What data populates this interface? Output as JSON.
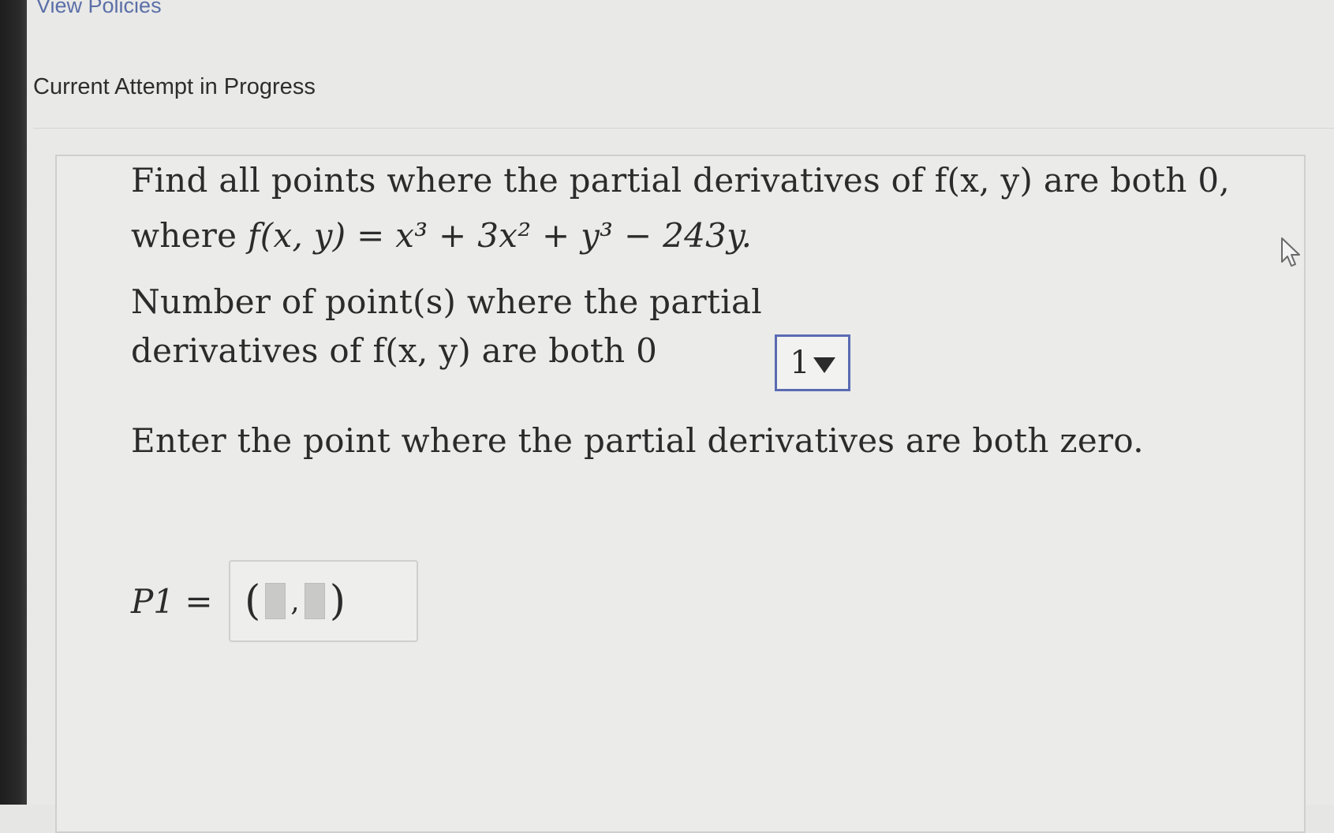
{
  "header": {
    "view_policies": "View Policies",
    "attempt_title": "Current Attempt in Progress"
  },
  "question": {
    "line1": "Find all points where the partial derivatives of f(x, y) are both 0,",
    "line2_prefix": "where ",
    "line2_math": "f(x, y) = x³ + 3x² + y³ − 243y.",
    "line3": "Number of point(s) where the partial",
    "line4": "derivatives of f(x, y) are both 0",
    "instruction": "Enter the point where the partial derivatives are both zero."
  },
  "count_dropdown": {
    "selected": "1",
    "icon": "caret-down-icon"
  },
  "answer": {
    "label": "P1 =",
    "open_paren": "(",
    "separator": ",",
    "close_paren": ")"
  },
  "colors": {
    "link": "#5b6fa8",
    "dropdown_border": "#5a6bb3",
    "text": "#2b2b2b"
  }
}
